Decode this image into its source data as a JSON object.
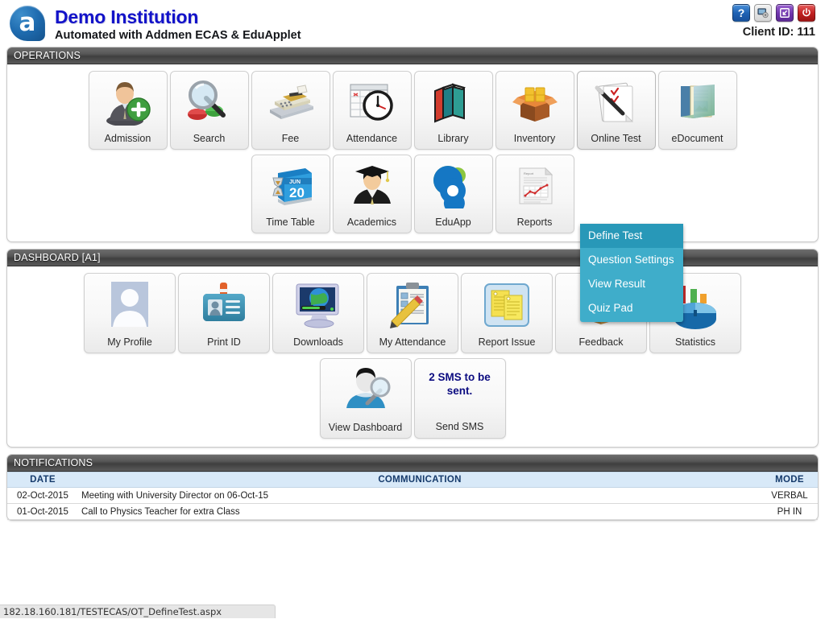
{
  "header": {
    "logo_letter": "a",
    "institution": "Demo Institution",
    "subtitle": "Automated with Addmen ECAS & EduApplet",
    "client_id": "Client ID: 111",
    "tools": [
      {
        "name": "help-icon",
        "label": "?"
      },
      {
        "name": "settings-icon",
        "label": ""
      },
      {
        "name": "login-icon",
        "label": ""
      },
      {
        "name": "power-icon",
        "label": ""
      }
    ]
  },
  "operations": {
    "title": "OPERATIONS",
    "row1": [
      {
        "label": "Admission",
        "icon": "admission-icon"
      },
      {
        "label": "Search",
        "icon": "search-icon"
      },
      {
        "label": "Fee",
        "icon": "fee-icon"
      },
      {
        "label": "Attendance",
        "icon": "attendance-icon"
      },
      {
        "label": "Library",
        "icon": "library-icon"
      },
      {
        "label": "Inventory",
        "icon": "inventory-icon"
      },
      {
        "label": "Online Test",
        "icon": "online-test-icon"
      },
      {
        "label": "eDocument",
        "icon": "edocument-icon"
      }
    ],
    "row2": [
      {
        "label": "Time Table",
        "icon": "time-table-icon"
      },
      {
        "label": "Academics",
        "icon": "academics-icon"
      },
      {
        "label": "EduApp",
        "icon": "eduapp-icon"
      },
      {
        "label": "Reports",
        "icon": "reports-icon"
      }
    ],
    "dropdown": {
      "parent": "Online Test",
      "items": [
        {
          "label": "Define Test",
          "selected": true
        },
        {
          "label": "Question Settings",
          "selected": false
        },
        {
          "label": "View Result",
          "selected": false
        },
        {
          "label": "Quiz Pad",
          "selected": false
        }
      ]
    }
  },
  "dashboard": {
    "title": "DASHBOARD [A1]",
    "row1": [
      {
        "label": "My Profile",
        "icon": "profile-icon"
      },
      {
        "label": "Print ID",
        "icon": "id-card-icon"
      },
      {
        "label": "Downloads",
        "icon": "downloads-icon"
      },
      {
        "label": "My Attendance",
        "icon": "my-attendance-icon"
      },
      {
        "label": "Report Issue",
        "icon": "report-issue-icon"
      },
      {
        "label": "Feedback",
        "icon": "feedback-box-icon"
      },
      {
        "label": "Statistics",
        "icon": "statistics-icon"
      }
    ],
    "row2": [
      {
        "label": "View Dashboard",
        "icon": "view-dashboard-icon"
      }
    ],
    "sms_tile": {
      "headline": "2 SMS to be sent.",
      "label": "Send SMS"
    }
  },
  "notifications": {
    "title": "NOTIFICATIONS",
    "columns": [
      "DATE",
      "COMMUNICATION",
      "MODE"
    ],
    "rows": [
      {
        "date": "02-Oct-2015",
        "communication": "Meeting with University Director on 06-Oct-15",
        "mode": "VERBAL"
      },
      {
        "date": "01-Oct-2015",
        "communication": "Call to Physics Teacher for extra Class",
        "mode": "PH IN"
      }
    ]
  },
  "statusbar": {
    "url": "182.18.160.181/TESTECAS/OT_DefineTest.aspx"
  },
  "colors": {
    "accent_menu": "#3fadca",
    "accent_menu_selected": "#2898b8",
    "title_blue": "#1212c9",
    "table_header": "#d8e9f8",
    "panel_header_dark": "#4a4a4a"
  }
}
